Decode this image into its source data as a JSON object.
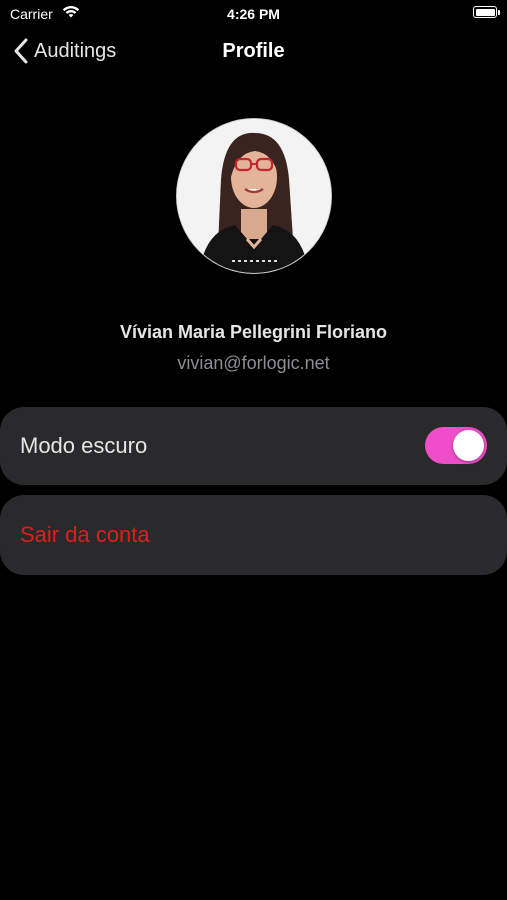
{
  "status_bar": {
    "carrier": "Carrier",
    "time": "4:26 PM",
    "wifi_icon": "wifi-icon",
    "battery_icon": "battery-icon"
  },
  "nav": {
    "back_label": "Auditings",
    "back_icon": "chevron-left-icon",
    "title": "Profile"
  },
  "profile": {
    "name": "Vívian Maria Pellegrini Floriano",
    "email": "vivian@forlogic.net"
  },
  "settings": {
    "dark_mode_label": "Modo escuro",
    "dark_mode_enabled": true,
    "logout_label": "Sair da conta"
  },
  "colors": {
    "background": "#000000",
    "row_background": "#2a2a2c",
    "toggle_on": "#ee4fc8",
    "logout_text": "#e01d1d",
    "secondary_text": "#8e8e93"
  }
}
